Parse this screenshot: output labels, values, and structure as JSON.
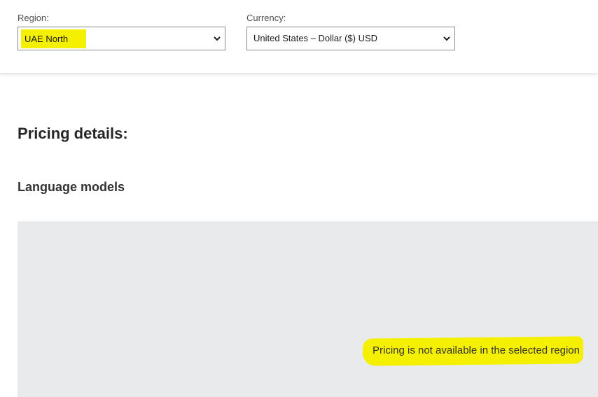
{
  "filters": {
    "region": {
      "label": "Region:",
      "value": "UAE North"
    },
    "currency": {
      "label": "Currency:",
      "value": "United States – Dollar ($) USD"
    }
  },
  "main": {
    "heading": "Pricing details:",
    "section_title": "Language models",
    "notice": "Pricing is not available in the selected region"
  },
  "colors": {
    "highlight": "#f4f000",
    "panel": "#e9eaeb"
  },
  "icons": {
    "dropdown": "chevron-down-icon"
  }
}
